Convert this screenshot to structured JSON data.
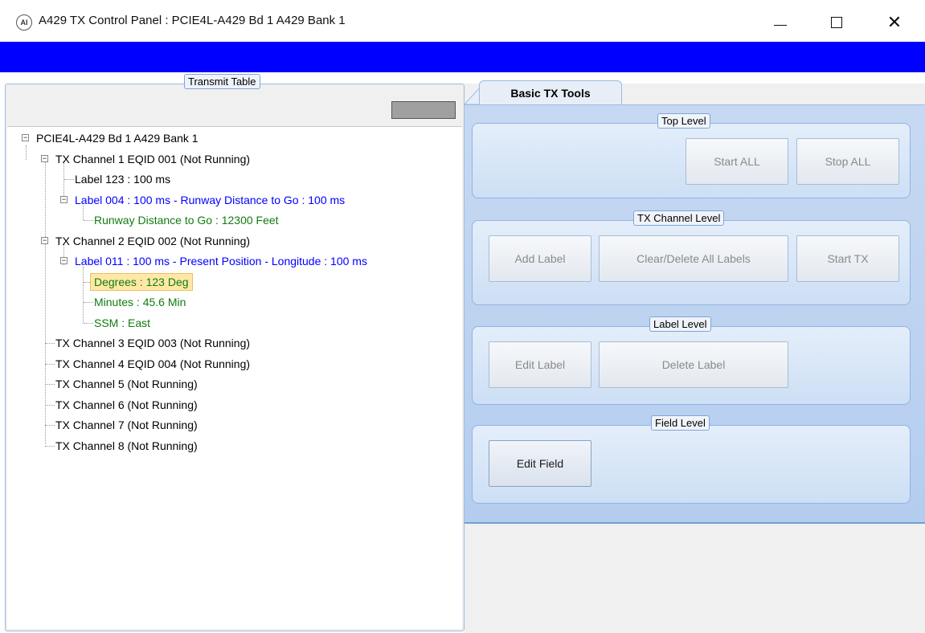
{
  "window": {
    "title": "A429 TX Control Panel : PCIE4L-A429 Bd 1 A429 Bank 1",
    "icon_text": "AI",
    "minimize_icon": "minimize-icon",
    "maximize_icon": "maximize-icon",
    "close_glyph": "✕"
  },
  "transmit_table": {
    "caption": "Transmit Table",
    "tree": [
      {
        "text": "PCIE4L-A429 Bd 1 A429 Bank 1",
        "level": 0,
        "color": "black",
        "expander": "−"
      },
      {
        "text": "TX Channel 1 EQID 001 (Not Running)",
        "level": 1,
        "color": "black",
        "expander": "−"
      },
      {
        "text": "Label 123 : 100 ms",
        "level": 2,
        "color": "black"
      },
      {
        "text": "Label 004 : 100 ms - Runway Distance to Go : 100 ms",
        "level": 2,
        "color": "blue",
        "expander": "−"
      },
      {
        "text": "Runway Distance to Go : 12300 Feet",
        "level": 3,
        "color": "green"
      },
      {
        "text": "TX Channel 2 EQID 002 (Not Running)",
        "level": 1,
        "color": "black",
        "expander": "−"
      },
      {
        "text": "Label 011 : 100 ms - Present Position - Longitude : 100 ms",
        "level": 2,
        "color": "blue",
        "expander": "−"
      },
      {
        "text": "Degrees : 123 Deg",
        "level": 3,
        "color": "green",
        "selected": true
      },
      {
        "text": "Minutes : 45.6 Min",
        "level": 3,
        "color": "green"
      },
      {
        "text": "SSM : East",
        "level": 3,
        "color": "green"
      },
      {
        "text": "TX Channel 3 EQID 003 (Not Running)",
        "level": 1,
        "color": "black"
      },
      {
        "text": "TX Channel 4 EQID 004 (Not Running)",
        "level": 1,
        "color": "black"
      },
      {
        "text": "TX Channel 5 (Not Running)",
        "level": 1,
        "color": "black"
      },
      {
        "text": "TX Channel 6 (Not Running)",
        "level": 1,
        "color": "black"
      },
      {
        "text": "TX Channel 7 (Not Running)",
        "level": 1,
        "color": "black"
      },
      {
        "text": "TX Channel 8 (Not Running)",
        "level": 1,
        "color": "black"
      }
    ]
  },
  "tools": {
    "tab_label": "Basic TX Tools",
    "top_level": {
      "caption": "Top Level",
      "start_all": "Start ALL",
      "stop_all": "Stop ALL"
    },
    "tx_channel_level": {
      "caption": "TX Channel Level",
      "add_label": "Add Label",
      "clear_delete": "Clear/Delete All Labels",
      "start_tx": "Start TX"
    },
    "label_level": {
      "caption": "Label Level",
      "edit_label": "Edit Label",
      "delete_label": "Delete Label"
    },
    "field_level": {
      "caption": "Field Level",
      "edit_field": "Edit Field"
    }
  },
  "colors": {
    "accent_blue_bar": "#0000ff",
    "tree_blue": "#0000ff",
    "tree_green": "#107c10"
  }
}
